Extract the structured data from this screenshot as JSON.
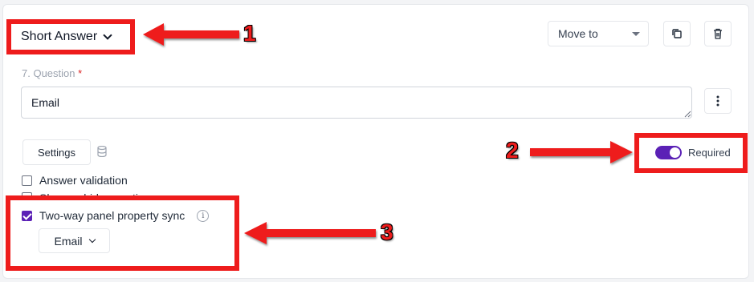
{
  "question_type": {
    "label": "Short Answer"
  },
  "move_to": {
    "label": "Move to"
  },
  "question": {
    "label": "7. Question",
    "required_marker": "*",
    "value": "Email"
  },
  "settings": {
    "label": "Settings"
  },
  "options": [
    {
      "label": "Answer validation",
      "checked": false
    },
    {
      "label": "Show or hide question",
      "checked": false
    },
    {
      "label": "Two-way panel property sync",
      "checked": true
    }
  ],
  "panel_property": {
    "label": "Email"
  },
  "required_toggle": {
    "label": "Required",
    "on": true
  },
  "annotations": {
    "one": "1",
    "two": "2",
    "three": "3"
  },
  "colors": {
    "accent": "#5b21b6",
    "annotation": "#ee1c1c"
  },
  "icons": [
    "chevron-down-icon",
    "caret-down-icon",
    "duplicate-icon",
    "trash-icon",
    "kebab-menu-icon",
    "database-icon",
    "info-icon",
    "resize-grip-icon",
    "arrow-icon"
  ]
}
